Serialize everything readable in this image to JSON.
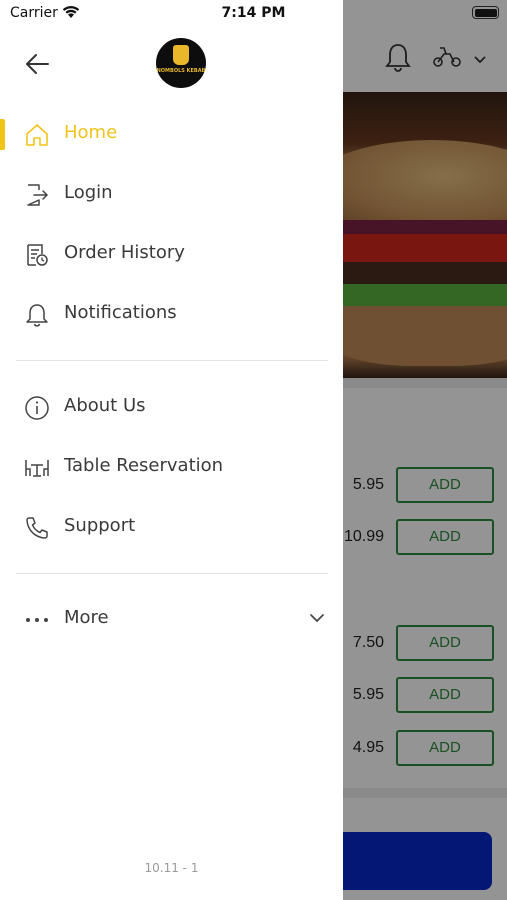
{
  "status_bar": {
    "carrier": "Carrier",
    "time": "7:14 PM"
  },
  "drawer": {
    "logo_text": "NOMBOLS KEBAB",
    "primary_items": [
      {
        "label": "Home",
        "icon": "home-icon",
        "active": true
      },
      {
        "label": "Login",
        "icon": "login-icon",
        "active": false
      },
      {
        "label": "Order History",
        "icon": "order-history-icon",
        "active": false
      },
      {
        "label": "Notifications",
        "icon": "bell-icon",
        "active": false
      }
    ],
    "secondary_items": [
      {
        "label": "About Us",
        "icon": "info-icon"
      },
      {
        "label": "Table Reservation",
        "icon": "table-icon"
      },
      {
        "label": "Support",
        "icon": "phone-icon"
      }
    ],
    "more": {
      "label": "More",
      "icon": "more-dots-icon"
    },
    "version": "10.11 - 1",
    "accent_color": "#f0c419"
  },
  "background": {
    "products": [
      {
        "price": "5.95",
        "add_label": "ADD"
      },
      {
        "price": "10.99",
        "add_label": "ADD"
      },
      {
        "price": "7.50",
        "add_label": "ADD"
      },
      {
        "price": "5.95",
        "add_label": "ADD"
      },
      {
        "price": "4.95",
        "add_label": "ADD"
      }
    ],
    "add_button_color": "#2e8b3e",
    "checkout_color": "#0a28c8"
  }
}
